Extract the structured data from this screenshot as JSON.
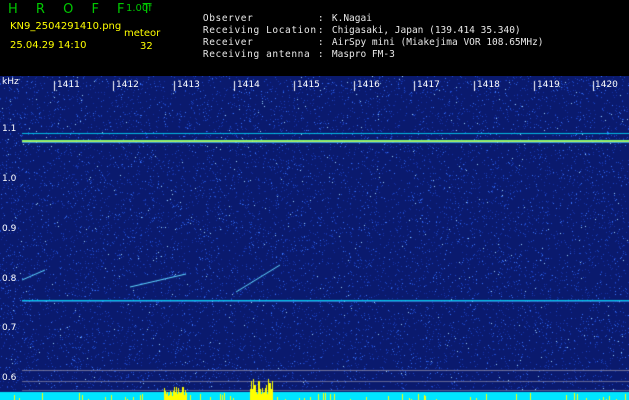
{
  "header": {
    "brand": "H R O F F T",
    "version": "1.00f",
    "filename": "KN9_2504291410.png",
    "datetime": "25.04.29 14:10",
    "meteor_label": "meteor",
    "meteor_count": "32",
    "info": [
      {
        "key": "Observer",
        "value": "K.Nagai"
      },
      {
        "key": "Receiving Location",
        "value": "Chigasaki, Japan (139.414 35.340)"
      },
      {
        "key": "Receiver",
        "value": "AirSpy mini (Miakejima VOR 108.65MHz)"
      },
      {
        "key": "Receiving antenna",
        "value": "Maspro FM-3"
      }
    ]
  },
  "spectrogram": {
    "y_unit": "kHz",
    "y_ticks": [
      "1.1",
      "1.0",
      "0.9",
      "0.8",
      "0.7",
      "0.6"
    ],
    "x_ticks": [
      "1411",
      "1412",
      "1413",
      "1414",
      "1415",
      "1416",
      "1417",
      "1418",
      "1419",
      "1420"
    ],
    "colors": {
      "background": "#0a1a6e",
      "noise": "#1e4cd0",
      "echo": "#c8ff60",
      "band": "#00e5ff",
      "peak": "#ffff00"
    }
  }
}
